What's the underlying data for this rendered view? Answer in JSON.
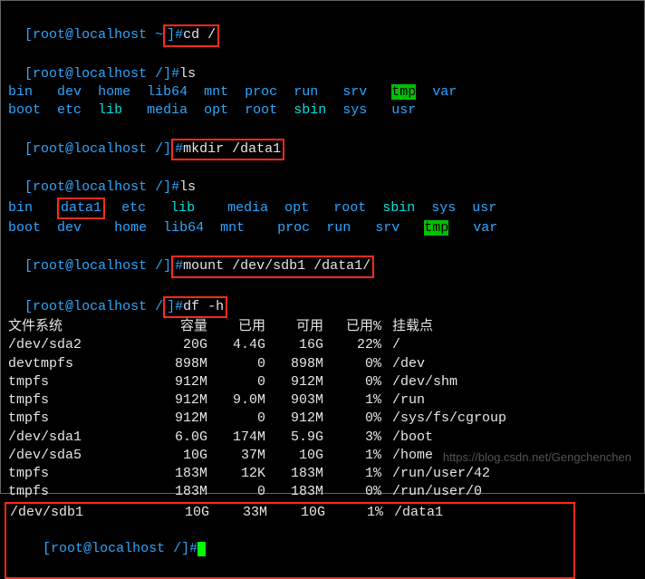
{
  "prompt": {
    "user": "root",
    "host": "localhost",
    "cwd_home": "~",
    "cwd_root": "/",
    "open": "[",
    "close": "]#",
    "at": "@"
  },
  "cmds": {
    "cd": "cd /",
    "ls1": "ls",
    "mkdir": "mkdir /data1",
    "ls2": "ls",
    "mount": "mount /dev/sdb1 /data1/",
    "df": "df -h"
  },
  "ls1": {
    "r1": [
      "bin",
      "dev",
      "home",
      "lib64",
      "mnt",
      "proc",
      "run",
      "srv",
      "tmp",
      "var"
    ],
    "r2": [
      "boot",
      "etc",
      "lib",
      "media",
      "opt",
      "root",
      "sbin",
      "sys",
      "usr",
      ""
    ]
  },
  "ls2": {
    "r1": [
      "bin",
      "data1",
      "etc",
      "lib",
      "media",
      "opt",
      "root",
      "sbin",
      "sys",
      "usr"
    ],
    "r2": [
      "boot",
      "dev",
      "home",
      "lib64",
      "mnt",
      "proc",
      "run",
      "srv",
      "tmp",
      "var"
    ]
  },
  "df": {
    "headers": [
      "文件系统",
      "容量",
      "已用",
      "可用",
      "已用%",
      "挂载点"
    ],
    "rows": [
      {
        "fs": "/dev/sda2",
        "size": "20G",
        "used": "4.4G",
        "avail": "16G",
        "pct": "22%",
        "mnt": "/"
      },
      {
        "fs": "devtmpfs",
        "size": "898M",
        "used": "0",
        "avail": "898M",
        "pct": "0%",
        "mnt": "/dev"
      },
      {
        "fs": "tmpfs",
        "size": "912M",
        "used": "0",
        "avail": "912M",
        "pct": "0%",
        "mnt": "/dev/shm"
      },
      {
        "fs": "tmpfs",
        "size": "912M",
        "used": "9.0M",
        "avail": "903M",
        "pct": "1%",
        "mnt": "/run"
      },
      {
        "fs": "tmpfs",
        "size": "912M",
        "used": "0",
        "avail": "912M",
        "pct": "0%",
        "mnt": "/sys/fs/cgroup"
      },
      {
        "fs": "/dev/sda1",
        "size": "6.0G",
        "used": "174M",
        "avail": "5.9G",
        "pct": "3%",
        "mnt": "/boot"
      },
      {
        "fs": "/dev/sda5",
        "size": "10G",
        "used": "37M",
        "avail": "10G",
        "pct": "1%",
        "mnt": "/home"
      },
      {
        "fs": "tmpfs",
        "size": "183M",
        "used": "12K",
        "avail": "183M",
        "pct": "1%",
        "mnt": "/run/user/42"
      },
      {
        "fs": "tmpfs",
        "size": "183M",
        "used": "0",
        "avail": "183M",
        "pct": "0%",
        "mnt": "/run/user/0"
      },
      {
        "fs": "/dev/sdb1",
        "size": "10G",
        "used": "33M",
        "avail": "10G",
        "pct": "1%",
        "mnt": "/data1"
      }
    ]
  },
  "watermark": "https://blog.csdn.net/Gengchenchen"
}
